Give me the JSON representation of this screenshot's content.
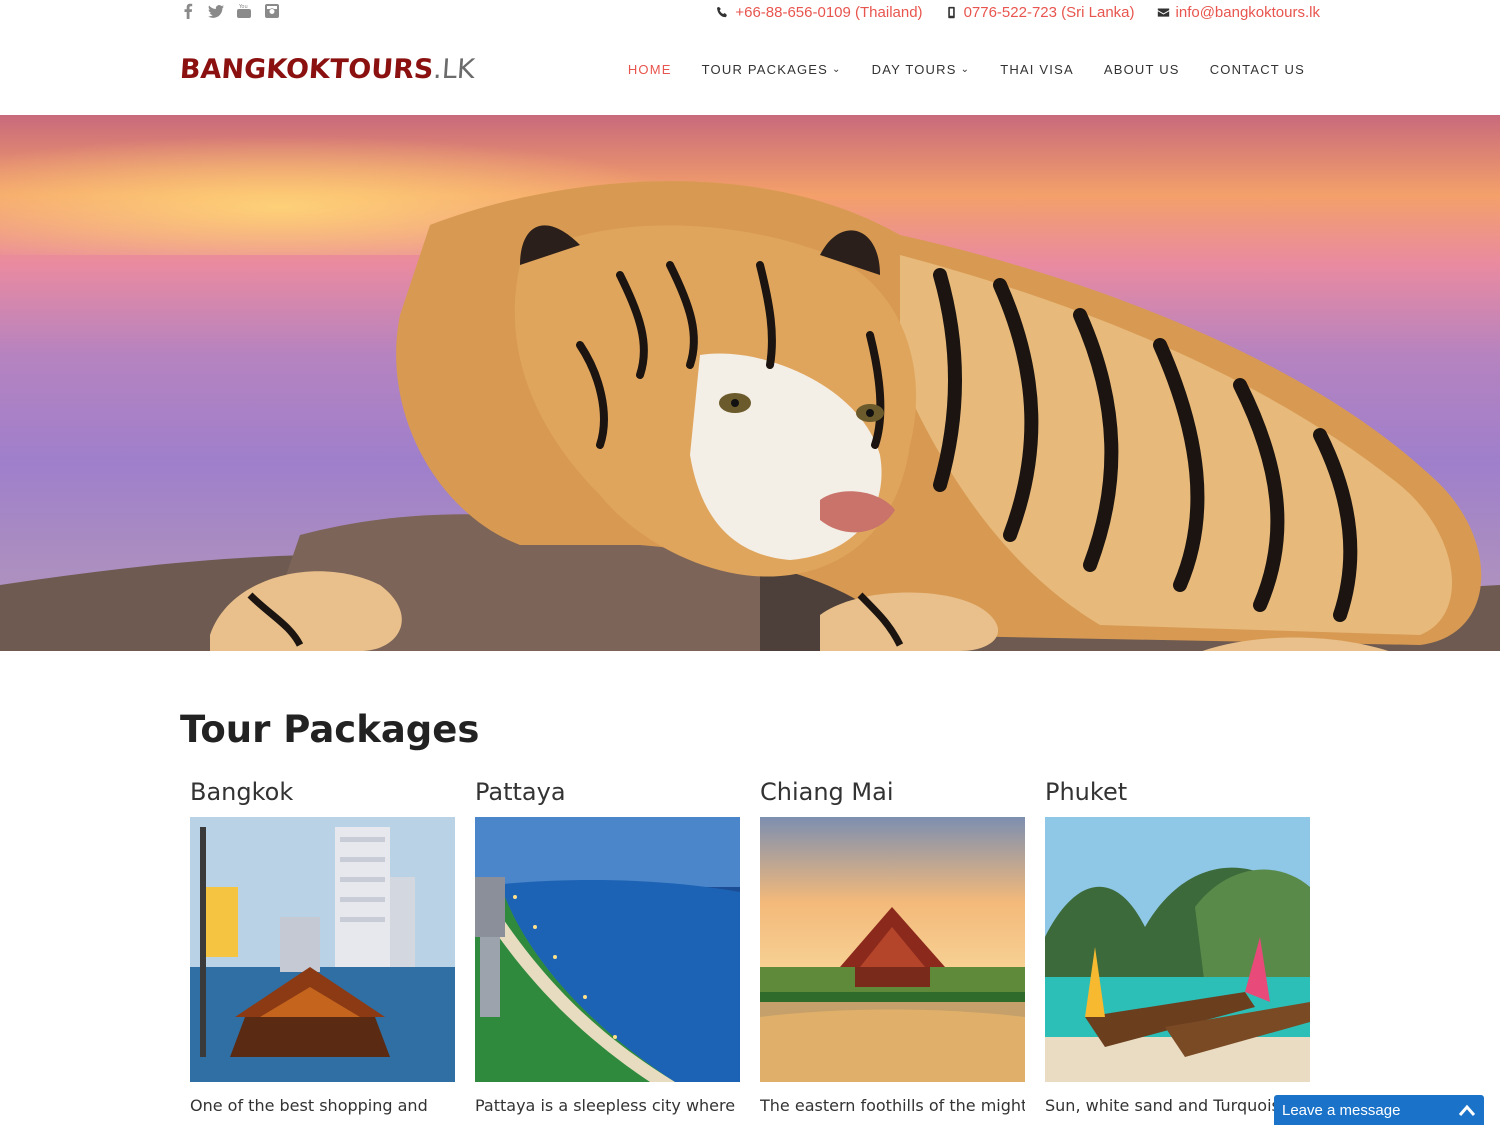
{
  "topbar": {
    "social": [
      {
        "name": "facebook-icon"
      },
      {
        "name": "twitter-icon"
      },
      {
        "name": "youtube-icon"
      },
      {
        "name": "instagram-icon"
      }
    ],
    "phone_thailand": "+66-88-656-0109 (Thailand)",
    "phone_srilanka": "0776-522-723 (Sri Lanka)",
    "email": "info@bangkoktours.lk"
  },
  "header": {
    "logo_main": "BANGKOKTOURS",
    "logo_tld": ".LK",
    "nav": [
      {
        "label": "HOME",
        "active": true,
        "dropdown": false
      },
      {
        "label": "TOUR PACKAGES",
        "active": false,
        "dropdown": true
      },
      {
        "label": "DAY TOURS",
        "active": false,
        "dropdown": true
      },
      {
        "label": "THAI VISA",
        "active": false,
        "dropdown": false
      },
      {
        "label": "ABOUT US",
        "active": false,
        "dropdown": false
      },
      {
        "label": "CONTACT US",
        "active": false,
        "dropdown": false
      }
    ]
  },
  "main": {
    "section_title": "Tour Packages",
    "cards": [
      {
        "title": "Bangkok",
        "text": "One of the best shopping and"
      },
      {
        "title": "Pattaya",
        "text": "Pattaya is a sleepless city where"
      },
      {
        "title": "Chiang Mai",
        "text": "The eastern foothills of the mighty"
      },
      {
        "title": "Phuket",
        "text": "Sun, white sand and Turquoise b"
      }
    ]
  },
  "chat": {
    "label": "Leave a message"
  },
  "colors": {
    "accent": "#e8554e",
    "logo": "#8b1010",
    "chat": "#1a73c9"
  }
}
